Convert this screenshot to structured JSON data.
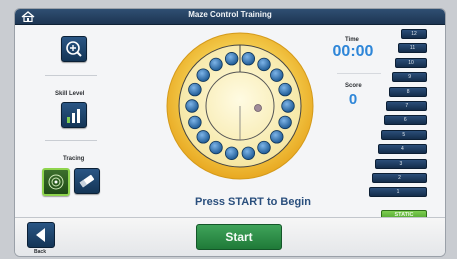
{
  "header": {
    "title": "Maze Control Training",
    "home_icon": "home-icon"
  },
  "left_panel": {
    "zoom_icon": "zoom-in-icon",
    "skill_label": "Skill Level",
    "skill_icon": "level-bars-icon",
    "tracing_label": "Tracing",
    "tracing_tools": [
      "target-icon",
      "eraser-icon"
    ]
  },
  "center": {
    "prompt": "Press START to Begin"
  },
  "stats": {
    "time_label": "Time",
    "time_value": "00:00",
    "score_label": "Score",
    "score_value": "0"
  },
  "levels": [
    "12",
    "11",
    "10",
    "9",
    "8",
    "7",
    "6",
    "5",
    "4",
    "3",
    "2",
    "1"
  ],
  "mode_button": "STATIC",
  "footer": {
    "back_label": "Back",
    "start_label": "Start"
  },
  "colors": {
    "accent_blue": "#2e86d8",
    "navy": "#1d3553",
    "green": "#2f8f47",
    "gold": "#f3c12b"
  }
}
